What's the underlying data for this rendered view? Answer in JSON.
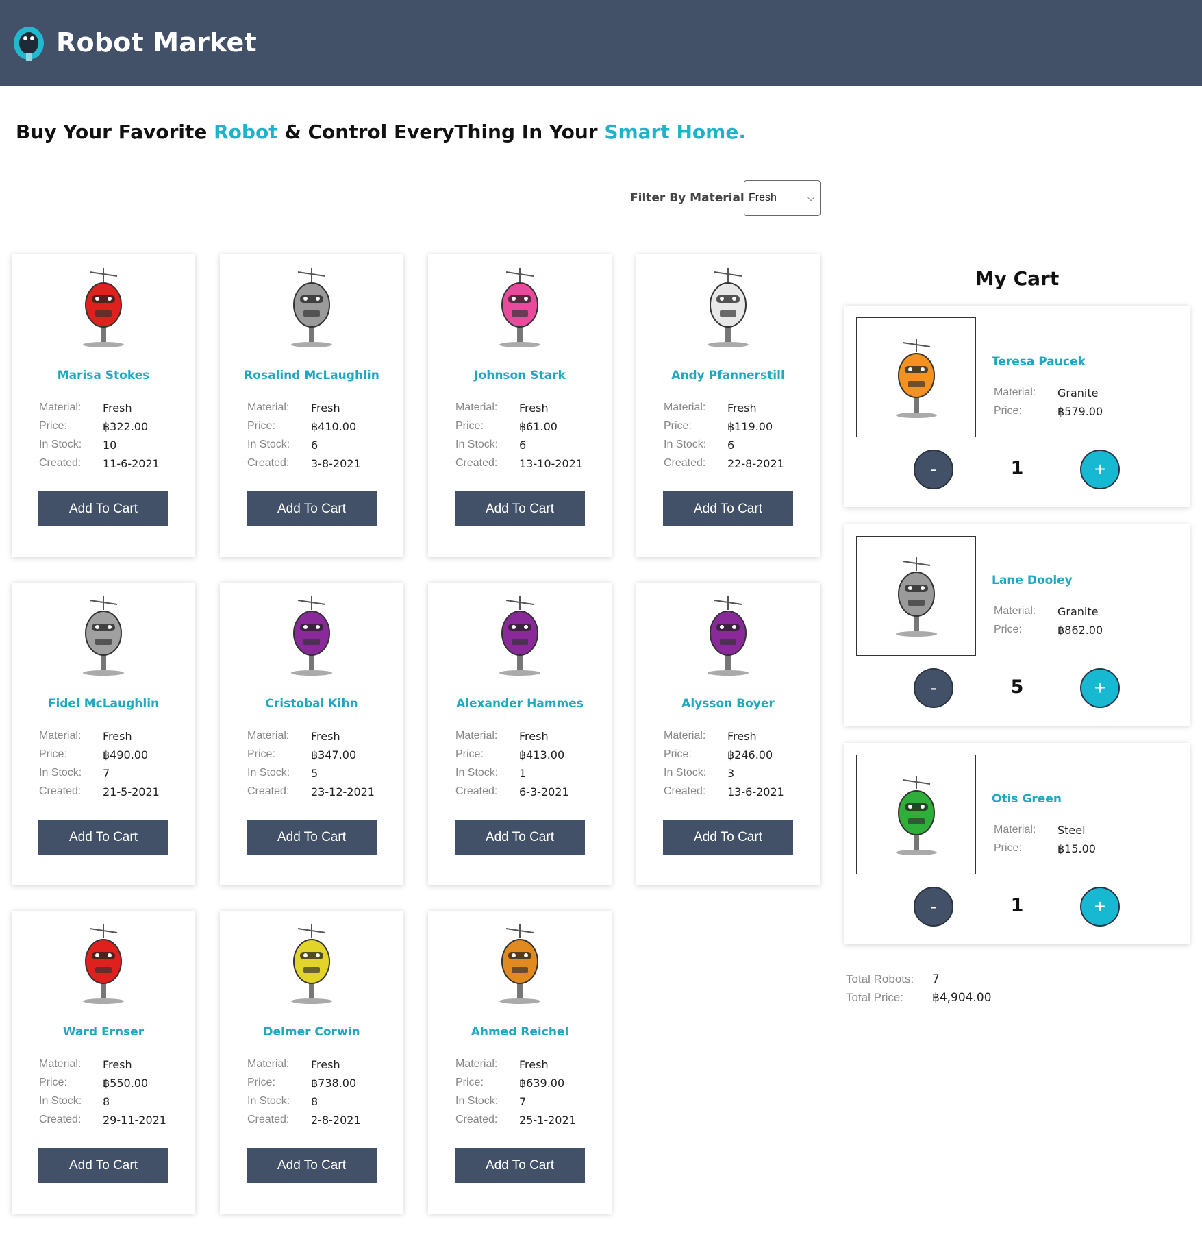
{
  "header": {
    "logo_icon": "robot-head-logo-icon",
    "title": "Robot Market",
    "bg_color": "#425168"
  },
  "tagline": {
    "part1": "Buy Your Favorite ",
    "accent1": "Robot",
    "part2": " & Control EveryThing In Your ",
    "accent2": "Smart Home.",
    "accent_color": "#1fb3c9"
  },
  "filter": {
    "label": "Filter By Material:",
    "selected": "Fresh"
  },
  "labels": {
    "material": "Material:",
    "price": "Price:",
    "stock": "In Stock:",
    "created": "Created:",
    "add_to_cart": "Add To Cart"
  },
  "products": [
    {
      "name": "Marisa Stokes",
      "material": "Fresh",
      "price": "฿322.00",
      "stock": "10",
      "created": "11-6-2021",
      "color": "#e0201d",
      "icon": "robot-avatar-red-antenna-icon"
    },
    {
      "name": "Rosalind McLaughlin",
      "material": "Fresh",
      "price": "฿410.00",
      "stock": "6",
      "created": "3-8-2021",
      "color": "#9a9a9a",
      "icon": "robot-avatar-grey-icon"
    },
    {
      "name": "Johnson Stark",
      "material": "Fresh",
      "price": "฿61.00",
      "stock": "6",
      "created": "13-10-2021",
      "color": "#ea4a9c",
      "icon": "robot-avatar-pink-icon"
    },
    {
      "name": "Andy Pfannerstill",
      "material": "Fresh",
      "price": "฿119.00",
      "stock": "6",
      "created": "22-8-2021",
      "color": "#e8e8e8",
      "icon": "robot-avatar-white-antenna-icon"
    },
    {
      "name": "Fidel McLaughlin",
      "material": "Fresh",
      "price": "฿490.00",
      "stock": "7",
      "created": "21-5-2021",
      "color": "#a0a0a0",
      "icon": "robot-avatar-grey-yellow-teeth-icon"
    },
    {
      "name": "Cristobal Kihn",
      "material": "Fresh",
      "price": "฿347.00",
      "stock": "5",
      "created": "23-12-2021",
      "color": "#8a2a9a",
      "icon": "robot-avatar-purple-icon"
    },
    {
      "name": "Alexander Hammes",
      "material": "Fresh",
      "price": "฿413.00",
      "stock": "1",
      "created": "6-3-2021",
      "color": "#8a2a9a",
      "icon": "robot-avatar-purple-icon"
    },
    {
      "name": "Alysson Boyer",
      "material": "Fresh",
      "price": "฿246.00",
      "stock": "3",
      "created": "13-6-2021",
      "color": "#8a2a9a",
      "icon": "robot-avatar-purple-icon"
    },
    {
      "name": "Ward Ernser",
      "material": "Fresh",
      "price": "฿550.00",
      "stock": "8",
      "created": "29-11-2021",
      "color": "#e0201d",
      "icon": "robot-avatar-red-antenna-icon"
    },
    {
      "name": "Delmer Corwin",
      "material": "Fresh",
      "price": "฿738.00",
      "stock": "8",
      "created": "2-8-2021",
      "color": "#e3d42a",
      "icon": "robot-avatar-yellow-icon"
    },
    {
      "name": "Ahmed Reichel",
      "material": "Fresh",
      "price": "฿639.00",
      "stock": "7",
      "created": "25-1-2021",
      "color": "#e08a20",
      "icon": "robot-avatar-orange-icon"
    }
  ],
  "cart": {
    "title": "My Cart",
    "items": [
      {
        "name": "Teresa Paucek",
        "material": "Granite",
        "price": "฿579.00",
        "qty": "1",
        "color": "#f39221",
        "icon": "robot-avatar-orange-icon"
      },
      {
        "name": "Lane Dooley",
        "material": "Granite",
        "price": "฿862.00",
        "qty": "5",
        "color": "#9a9a9a",
        "icon": "robot-avatar-grey-icon"
      },
      {
        "name": "Otis Green",
        "material": "Steel",
        "price": "฿15.00",
        "qty": "1",
        "color": "#2fae3a",
        "icon": "robot-avatar-green-icon"
      }
    ],
    "minus_label": "-",
    "plus_label": "+",
    "total_robots_label": "Total Robots:",
    "total_robots": "7",
    "total_price_label": "Total Price:",
    "total_price": "฿4,904.00"
  }
}
